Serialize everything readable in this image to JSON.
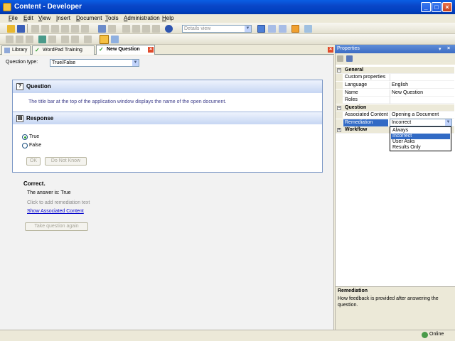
{
  "window": {
    "title": "Content - Developer"
  },
  "menu": [
    {
      "label": "File",
      "hotkey": "F",
      "rest": "ile"
    },
    {
      "label": "Edit",
      "hotkey": "E",
      "rest": "dit"
    },
    {
      "label": "View",
      "hotkey": "V",
      "rest": "iew"
    },
    {
      "label": "Insert",
      "hotkey": "I",
      "rest": "nsert"
    },
    {
      "label": "Document",
      "hotkey": "D",
      "rest": "ocument"
    },
    {
      "label": "Tools",
      "hotkey": "T",
      "rest": "ools"
    },
    {
      "label": "Administration",
      "hotkey": "A",
      "rest": "dministration"
    },
    {
      "label": "Help",
      "hotkey": "H",
      "rest": "elp"
    }
  ],
  "toolbar": {
    "view_select": "Details view"
  },
  "tabs": [
    {
      "label": "Library",
      "icon": "library-icon"
    },
    {
      "label": "WordPad Training",
      "icon": "check-doc-icon"
    },
    {
      "label": "New Question",
      "icon": "check-doc-icon",
      "active": true
    }
  ],
  "editor": {
    "question_type_label": "Question type:",
    "question_type_value": "True/False",
    "question_header": "Question",
    "question_text": "The title bar at the top of the application window displays the name of the open document.",
    "response_header": "Response",
    "options": [
      {
        "label": "True",
        "selected": true
      },
      {
        "label": "False",
        "selected": false
      }
    ],
    "ok_label": "OK",
    "dont_know_label": "Do Not Know",
    "feedback_title": "Correct.",
    "answer_text": "The answer is: True",
    "remediation_hint": "Click to add remediation text",
    "assoc_link": "Show Associated Content",
    "retake_label": "Take question again"
  },
  "properties": {
    "title": "Properties",
    "categories": {
      "general": "General",
      "question": "Question",
      "workflow": "Workflow"
    },
    "rows": {
      "custom": {
        "key": "Custom properties",
        "value": ""
      },
      "language": {
        "key": "Language",
        "value": "English"
      },
      "name": {
        "key": "Name",
        "value": "New Question"
      },
      "roles": {
        "key": "Roles",
        "value": ""
      },
      "assoc": {
        "key": "Associated Content",
        "value": "Opening a Document"
      },
      "remediation": {
        "key": "Remediation",
        "value": "Incorrect"
      }
    },
    "remediation_options": [
      "Always",
      "Incorrect",
      "User Asks",
      "Results Only"
    ],
    "remediation_selected": "Incorrect",
    "description_title": "Remediation",
    "description_text": "How feedback is provided after answering the question."
  },
  "status": {
    "text": "Online"
  },
  "colors": {
    "titlebar": "#0a5ee4",
    "selection": "#316ac5",
    "link": "#0000cc",
    "section_header": "#c6d6f3"
  }
}
